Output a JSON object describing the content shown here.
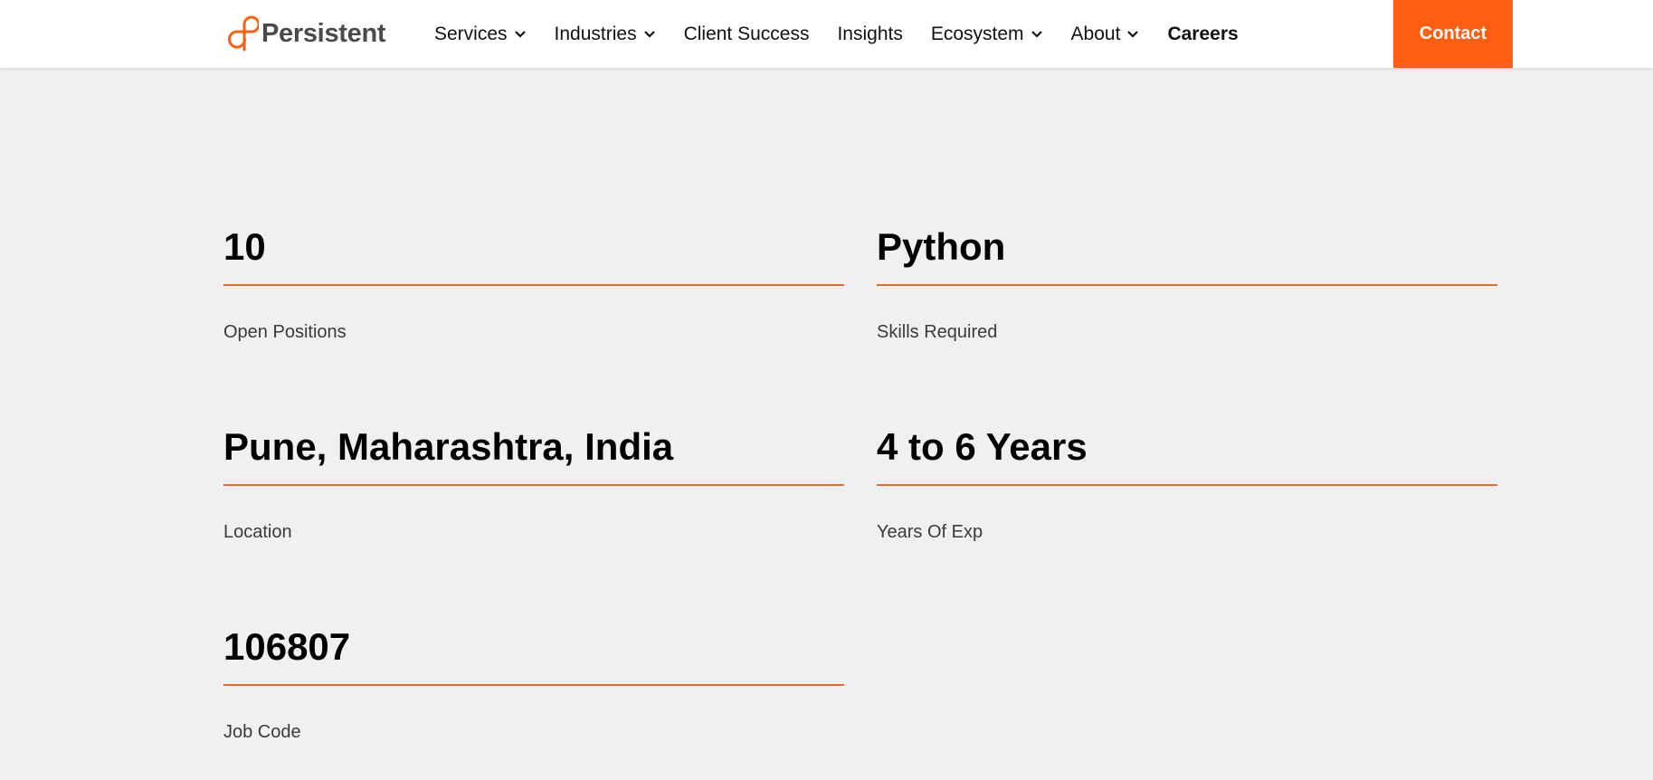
{
  "header": {
    "logo_text": "Persistent",
    "nav": [
      {
        "label": "Services",
        "has_dropdown": true,
        "bold": false
      },
      {
        "label": "Industries",
        "has_dropdown": true,
        "bold": false
      },
      {
        "label": "Client Success",
        "has_dropdown": false,
        "bold": false
      },
      {
        "label": "Insights",
        "has_dropdown": false,
        "bold": false
      },
      {
        "label": "Ecosystem",
        "has_dropdown": true,
        "bold": false
      },
      {
        "label": "About",
        "has_dropdown": true,
        "bold": false
      },
      {
        "label": "Careers",
        "has_dropdown": false,
        "bold": true
      }
    ],
    "contact_label": "Contact"
  },
  "job": {
    "open_positions": {
      "value": "10",
      "label": "Open Positions"
    },
    "skills": {
      "value": "Python",
      "label": "Skills Required"
    },
    "location": {
      "value": "Pune, Maharashtra, India",
      "label": "Location"
    },
    "experience": {
      "value": "4 to 6 Years",
      "label": "Years Of Exp"
    },
    "job_code": {
      "value": "106807",
      "label": "Job Code"
    }
  },
  "colors": {
    "accent": "#ff5f0f",
    "rule": "#e8692a",
    "background": "#f0f0f0",
    "header_bg": "#ffffff"
  },
  "icons": {
    "logo": "persistent-logo-icon",
    "dropdown": "chevron-down-icon"
  }
}
